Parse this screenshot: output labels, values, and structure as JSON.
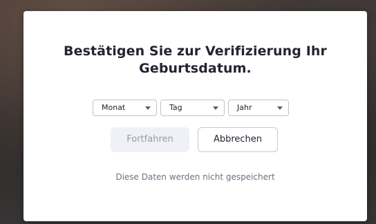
{
  "dialog": {
    "title": "Bestätigen Sie zur Verifizierung Ihr\nGeburtsdatum.",
    "month_select": {
      "selected": "Monat",
      "icon": "chevron-down-icon"
    },
    "day_select": {
      "selected": "Tag",
      "icon": "chevron-down-icon"
    },
    "year_select": {
      "selected": "Jahr",
      "icon": "chevron-down-icon"
    },
    "continue_label": "Fortfahren",
    "cancel_label": "Abbrechen",
    "note": "Diese Daten werden nicht gespeichert"
  },
  "colors": {
    "title_text": "#232333",
    "disabled_button_bg": "#f0f1f7",
    "disabled_button_text": "#9a9caa",
    "note_text": "#6e7080"
  }
}
